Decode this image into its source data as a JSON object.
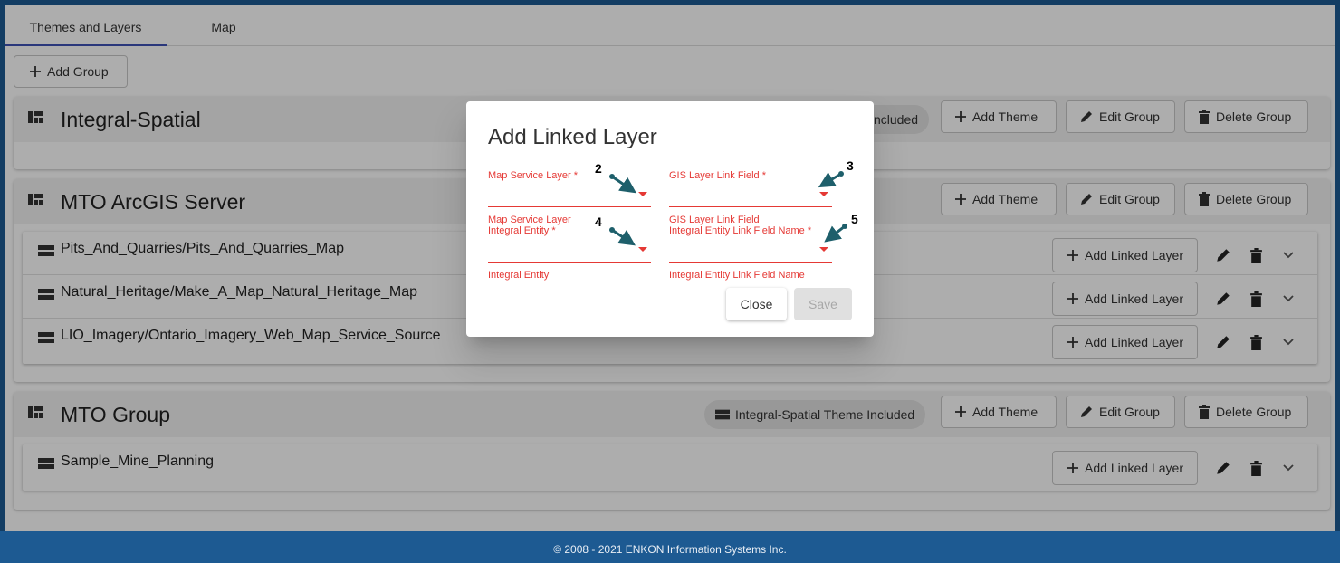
{
  "tabs": [
    {
      "label": "Themes and Layers",
      "active": true
    },
    {
      "label": "Map",
      "active": false
    }
  ],
  "toolbar": {
    "add_group_label": "Add Group"
  },
  "group_actions": {
    "add_theme": "Add Theme",
    "edit_group": "Edit Group",
    "delete_group": "Delete Group",
    "add_linked_layer": "Add Linked Layer"
  },
  "groups": [
    {
      "title": "Integral-Spatial",
      "chip": "ncluded",
      "layers": []
    },
    {
      "title": "MTO ArcGIS Server",
      "chip": "",
      "layers": [
        {
          "name": "Pits_And_Quarries/Pits_And_Quarries_Map"
        },
        {
          "name": "Natural_Heritage/Make_A_Map_Natural_Heritage_Map"
        },
        {
          "name": "LIO_Imagery/Ontario_Imagery_Web_Map_Service_Source"
        }
      ]
    },
    {
      "title": "MTO Group",
      "chip": "Integral-Spatial Theme Included",
      "layers": [
        {
          "name": "Sample_Mine_Planning"
        }
      ]
    }
  ],
  "dialog": {
    "title": "Add Linked Layer",
    "fields": {
      "map_service_layer": "Map Service Layer *",
      "gis_layer_link_field": "GIS Layer Link Field *",
      "integral_entity_label_1": "Map Service Layer",
      "integral_entity_label_2": "Integral Entity *",
      "integral_entity_hint": "Integral Entity",
      "link_field_name_label_1": "GIS Layer Link Field",
      "link_field_name_label_2": "Integral Entity Link Field Name *",
      "link_field_name_hint": "Integral Entity Link Field Name"
    },
    "callouts": [
      "2",
      "3",
      "4",
      "5"
    ],
    "close_label": "Close",
    "save_label": "Save"
  },
  "footer": "© 2008 - 2021 ENKON Information Systems Inc.",
  "colors": {
    "accent": "#3f51b5",
    "error": "#e53935",
    "arrow": "#1e5f6b",
    "frame": "#1d5a92"
  }
}
